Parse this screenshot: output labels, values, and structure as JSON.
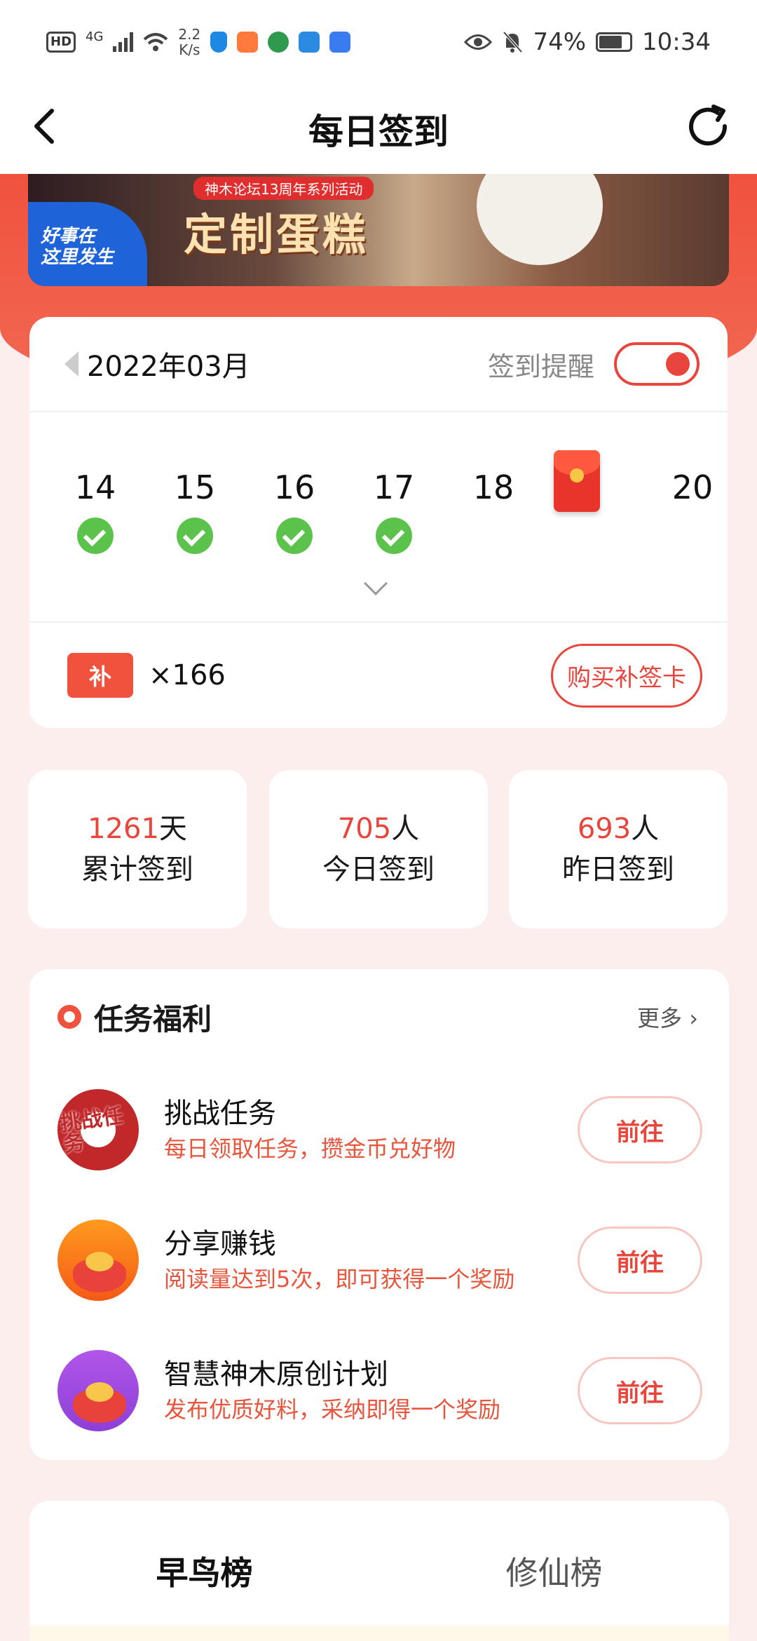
{
  "status_bar": {
    "hd": "HD",
    "network": "4G",
    "speed_value": "2.2",
    "speed_unit": "K/s",
    "battery": "74%",
    "time": "10:34"
  },
  "nav": {
    "title": "每日签到"
  },
  "banner": {
    "tag": "神木论坛13周年系列活动",
    "headline": "定制蛋糕",
    "badge_line1": "好事在",
    "badge_line2": "这里发生"
  },
  "calendar": {
    "month": "2022年03月",
    "remind_label": "签到提醒",
    "remind_on": true,
    "days": [
      {
        "num": "14",
        "checked": true
      },
      {
        "num": "15",
        "checked": true
      },
      {
        "num": "16",
        "checked": true
      },
      {
        "num": "17",
        "checked": true
      },
      {
        "num": "18",
        "checked": false
      },
      {
        "num": "",
        "red_packet": true
      },
      {
        "num": "20",
        "checked": false
      }
    ],
    "makeup_ticket_label": "补",
    "makeup_count": "×166",
    "buy_label": "购买补签卡"
  },
  "stats": [
    {
      "value": "1261",
      "unit": "天",
      "label": "累计签到"
    },
    {
      "value": "705",
      "unit": "人",
      "label": "今日签到"
    },
    {
      "value": "693",
      "unit": "人",
      "label": "昨日签到"
    }
  ],
  "tasks": {
    "title": "任务福利",
    "more": "更多",
    "items": [
      {
        "name": "挑战任务",
        "desc": "每日领取任务，攒金币兑好物",
        "button": "前往",
        "icon": "challenge-icon",
        "icon_text": "挑战任务"
      },
      {
        "name": "分享赚钱",
        "desc": "阅读量达到5次，即可获得一个奖励",
        "button": "前往",
        "icon": "share-icon"
      },
      {
        "name": "智慧神木原创计划",
        "desc": "发布优质好料，采纳即得一个奖励",
        "button": "前往",
        "icon": "megaphone-icon"
      }
    ]
  },
  "rank": {
    "tabs": [
      "早鸟榜",
      "修仙榜"
    ],
    "active": 0
  },
  "colors": {
    "accent": "#e8453c",
    "check": "#5bc24b",
    "page_bg": "#fdeeee"
  }
}
